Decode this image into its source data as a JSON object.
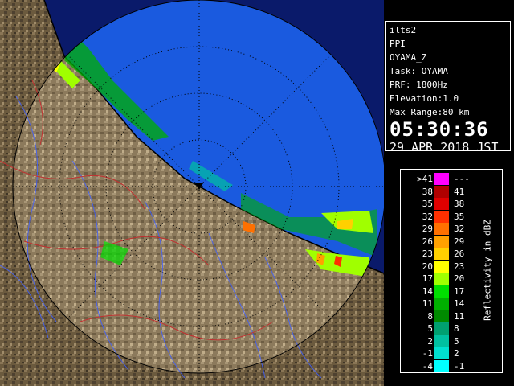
{
  "info": {
    "site": "ilts2",
    "product": "PPI",
    "product_name": "OYAMA_Z",
    "task": "Task: OYAMA",
    "prf": "PRF: 1800Hz",
    "elevation": "Elevation:1.0",
    "max_range": "Max Range:80 km",
    "time": "05:30:36",
    "date": "29 APR 2018 JST"
  },
  "legend": {
    "unit": "Reflectivity in dBZ",
    "rows": [
      {
        "lo": ">41",
        "hi": "---",
        "color": "#ff00ff"
      },
      {
        "lo": "38",
        "hi": "41",
        "color": "#b00000"
      },
      {
        "lo": "35",
        "hi": "38",
        "color": "#e00000"
      },
      {
        "lo": "32",
        "hi": "35",
        "color": "#ff3000"
      },
      {
        "lo": "29",
        "hi": "32",
        "color": "#ff7000"
      },
      {
        "lo": "26",
        "hi": "29",
        "color": "#ffa000"
      },
      {
        "lo": "23",
        "hi": "26",
        "color": "#ffd000"
      },
      {
        "lo": "20",
        "hi": "23",
        "color": "#ffff00"
      },
      {
        "lo": "17",
        "hi": "20",
        "color": "#a0ff00"
      },
      {
        "lo": "14",
        "hi": "17",
        "color": "#00e000"
      },
      {
        "lo": "11",
        "hi": "14",
        "color": "#00b000"
      },
      {
        "lo": "8",
        "hi": "11",
        "color": "#008a00"
      },
      {
        "lo": "5",
        "hi": "8",
        "color": "#00a070"
      },
      {
        "lo": "2",
        "hi": "5",
        "color": "#00c0a0"
      },
      {
        "lo": "-1",
        "hi": "2",
        "color": "#00e0d0"
      },
      {
        "lo": "-4",
        "hi": "-1",
        "color": "#00ffff"
      }
    ]
  },
  "map": {
    "sea_color": "#1a5adf",
    "outside_color": "#0a1a6a",
    "land_color": "#6b5a3e",
    "coast_color": "#000000",
    "river_color": "#4060ff",
    "boundary_color": "#c03030"
  }
}
